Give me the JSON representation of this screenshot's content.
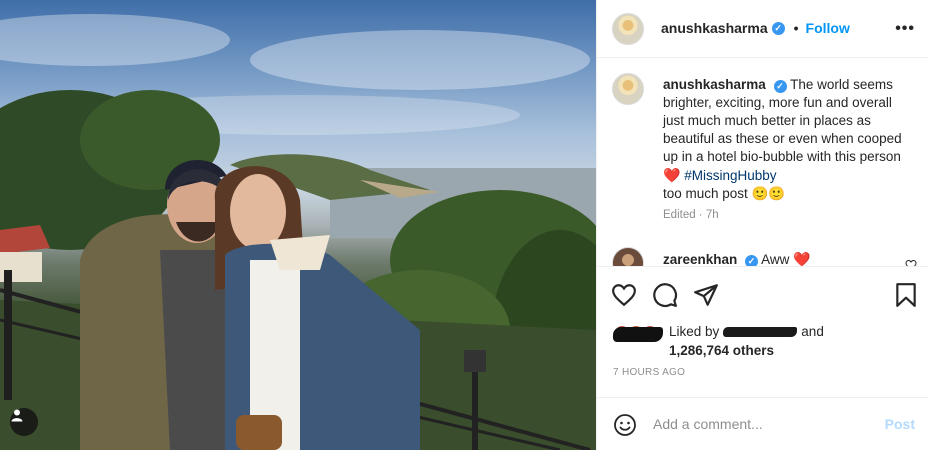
{
  "header": {
    "username": "anushkasharma",
    "separator": "•",
    "follow_label": "Follow",
    "more_label": "•••"
  },
  "caption": {
    "username": "anushkasharma",
    "text": "The world seems brighter, exciting, more fun and overall just much much better in places as beautiful as these or even when cooped up in a hotel bio-bubble with this person",
    "emoji": "❤️",
    "hashtag": "#MissingHubby",
    "tail": "too much post 🙂🙂",
    "edited": "Edited · 7h"
  },
  "comment": {
    "username": "zareenkhan",
    "text": "Aww",
    "emoji": "❤️"
  },
  "likes": {
    "prefix": "Liked by",
    "suffix": "and",
    "count_text": "1,286,764 others"
  },
  "time_ago": "7 HOURS AGO",
  "add_comment": {
    "placeholder": "Add a comment...",
    "post_label": "Post"
  },
  "icons": {
    "verified": "verified-badge-icon",
    "like": "heart-icon",
    "comment": "comment-icon",
    "share": "share-icon",
    "save": "bookmark-icon",
    "emoji": "emoji-icon",
    "user_tag": "user-tag-icon"
  },
  "colors": {
    "accent": "#0095f6",
    "verified": "#3897f0",
    "hashtag": "#00376b",
    "muted": "#8e8e8e",
    "heart_red": "#e0182d",
    "post_disabled": "#b3dbff"
  }
}
